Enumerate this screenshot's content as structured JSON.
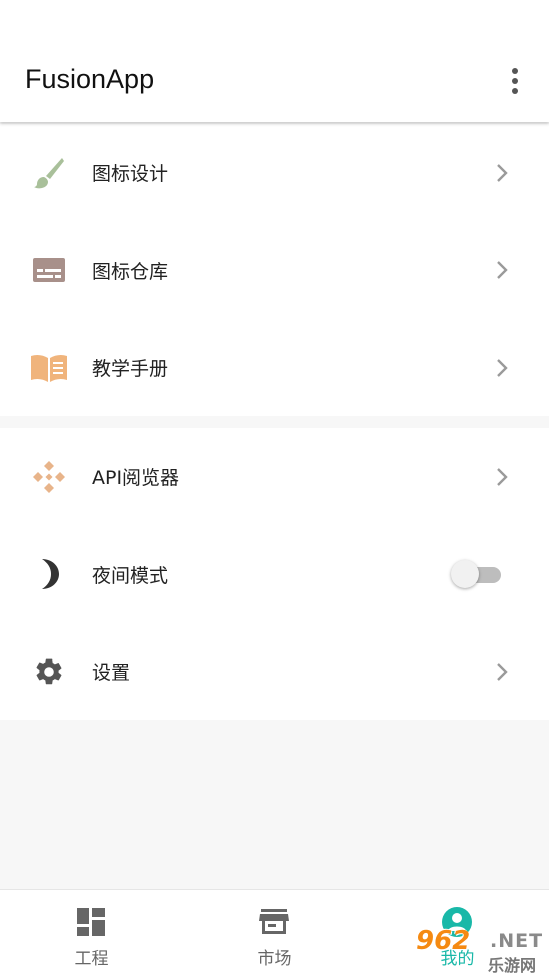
{
  "appbar": {
    "title": "FusionApp"
  },
  "menu_group_1": {
    "items": [
      {
        "label": "图标设计",
        "icon": "paintbrush-icon",
        "icon_color": "#a9c09a"
      },
      {
        "label": "图标仓库",
        "icon": "subtitles-icon",
        "icon_color": "#a8908a"
      },
      {
        "label": "教学手册",
        "icon": "open-book-icon",
        "icon_color": "#f0b47c"
      }
    ]
  },
  "menu_group_2": {
    "items": [
      {
        "label": "API阅览器",
        "icon": "diamond-dots-icon",
        "icon_color": "#e8b48a"
      },
      {
        "label": "夜间模式",
        "icon": "crescent-moon-icon",
        "icon_color": "#333333",
        "toggle": false
      },
      {
        "label": "设置",
        "icon": "gear-icon",
        "icon_color": "#555555"
      }
    ]
  },
  "bottom_nav": {
    "items": [
      {
        "label": "工程",
        "icon": "dashboard-icon"
      },
      {
        "label": "市场",
        "icon": "store-icon"
      },
      {
        "label": "我的",
        "icon": "person-icon",
        "active": true
      }
    ],
    "active_color": "#19b8a8"
  },
  "watermark": {
    "number": "962",
    "suffix": ".NET",
    "site": "乐游网"
  }
}
